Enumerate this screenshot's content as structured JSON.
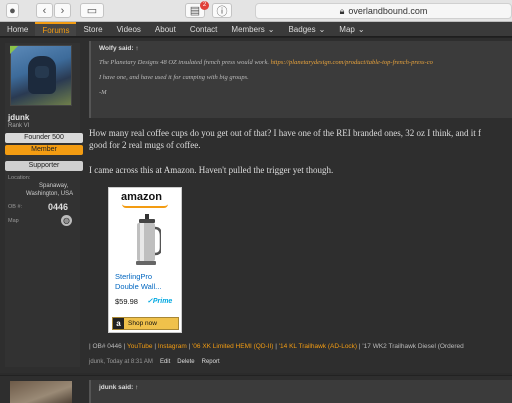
{
  "browser": {
    "url": "overlandbound.com",
    "notification_count": "2"
  },
  "nav": {
    "items": [
      {
        "label": "Home"
      },
      {
        "label": "Forums",
        "active": true
      },
      {
        "label": "Store"
      },
      {
        "label": "Videos"
      },
      {
        "label": "About"
      },
      {
        "label": "Contact"
      },
      {
        "label": "Members",
        "dropdown": true
      },
      {
        "label": "Badges",
        "dropdown": true
      },
      {
        "label": "Map",
        "dropdown": true
      }
    ]
  },
  "post1": {
    "user": {
      "name": "jdunk",
      "rank": "Rank VI",
      "badges": [
        "Founder 500",
        "Member",
        "Supporter"
      ],
      "location_label": "Location:",
      "location_value_1": "Spanaway,",
      "location_value_2": "Washington, USA",
      "ob_label": "OB #:",
      "ob_value": "0446",
      "map_label": "Map"
    },
    "quote": {
      "author": "Wolfy said: ↑",
      "line1_text": "The Planetary Designs 48 OZ insulated french press would work.",
      "line1_link": "https://planetarydesign.com/product/table-top-french-press-co",
      "line2": "I have one, and have used it for camping with big groups.",
      "line3": "-M"
    },
    "body": {
      "para1_line1": "How many real coffee cups do you get out of that? I have one of the REI branded ones, 32 oz I think, and it f",
      "para1_line2": "good for 2 real mugs of coffee.",
      "para2": "I came across this at Amazon. Haven't pulled the trigger yet though."
    },
    "ad": {
      "brand": "amazon",
      "title_1": "SterlingPro",
      "title_2": "Double Wall...",
      "price": "$59.98",
      "prime": "✓Prime",
      "shop_label": "Shop now",
      "shop_icon": "a"
    },
    "signature": {
      "prefix": "| OB# 0446 |",
      "links": [
        "YouTube",
        "Instagram",
        "'06 XK Limited HEMI (QD-II)",
        "'14 KL Trailhawk (AD-Lock)"
      ],
      "suffix": "| '17 WK2 Trailhawk Diesel (Ordered"
    },
    "meta": {
      "byline": "jdunk, Today at 8:31 AM",
      "actions": [
        "Edit",
        "Delete",
        "Report"
      ]
    }
  },
  "post2": {
    "quote_author": "jdunk said: ↑"
  },
  "colors": {
    "accent": "#f39c12",
    "background": "#2b2b2b",
    "founder_badge": "#d9d9d9",
    "member_badge": "#f39c12",
    "supporter_badge": "#cfcfcf"
  }
}
